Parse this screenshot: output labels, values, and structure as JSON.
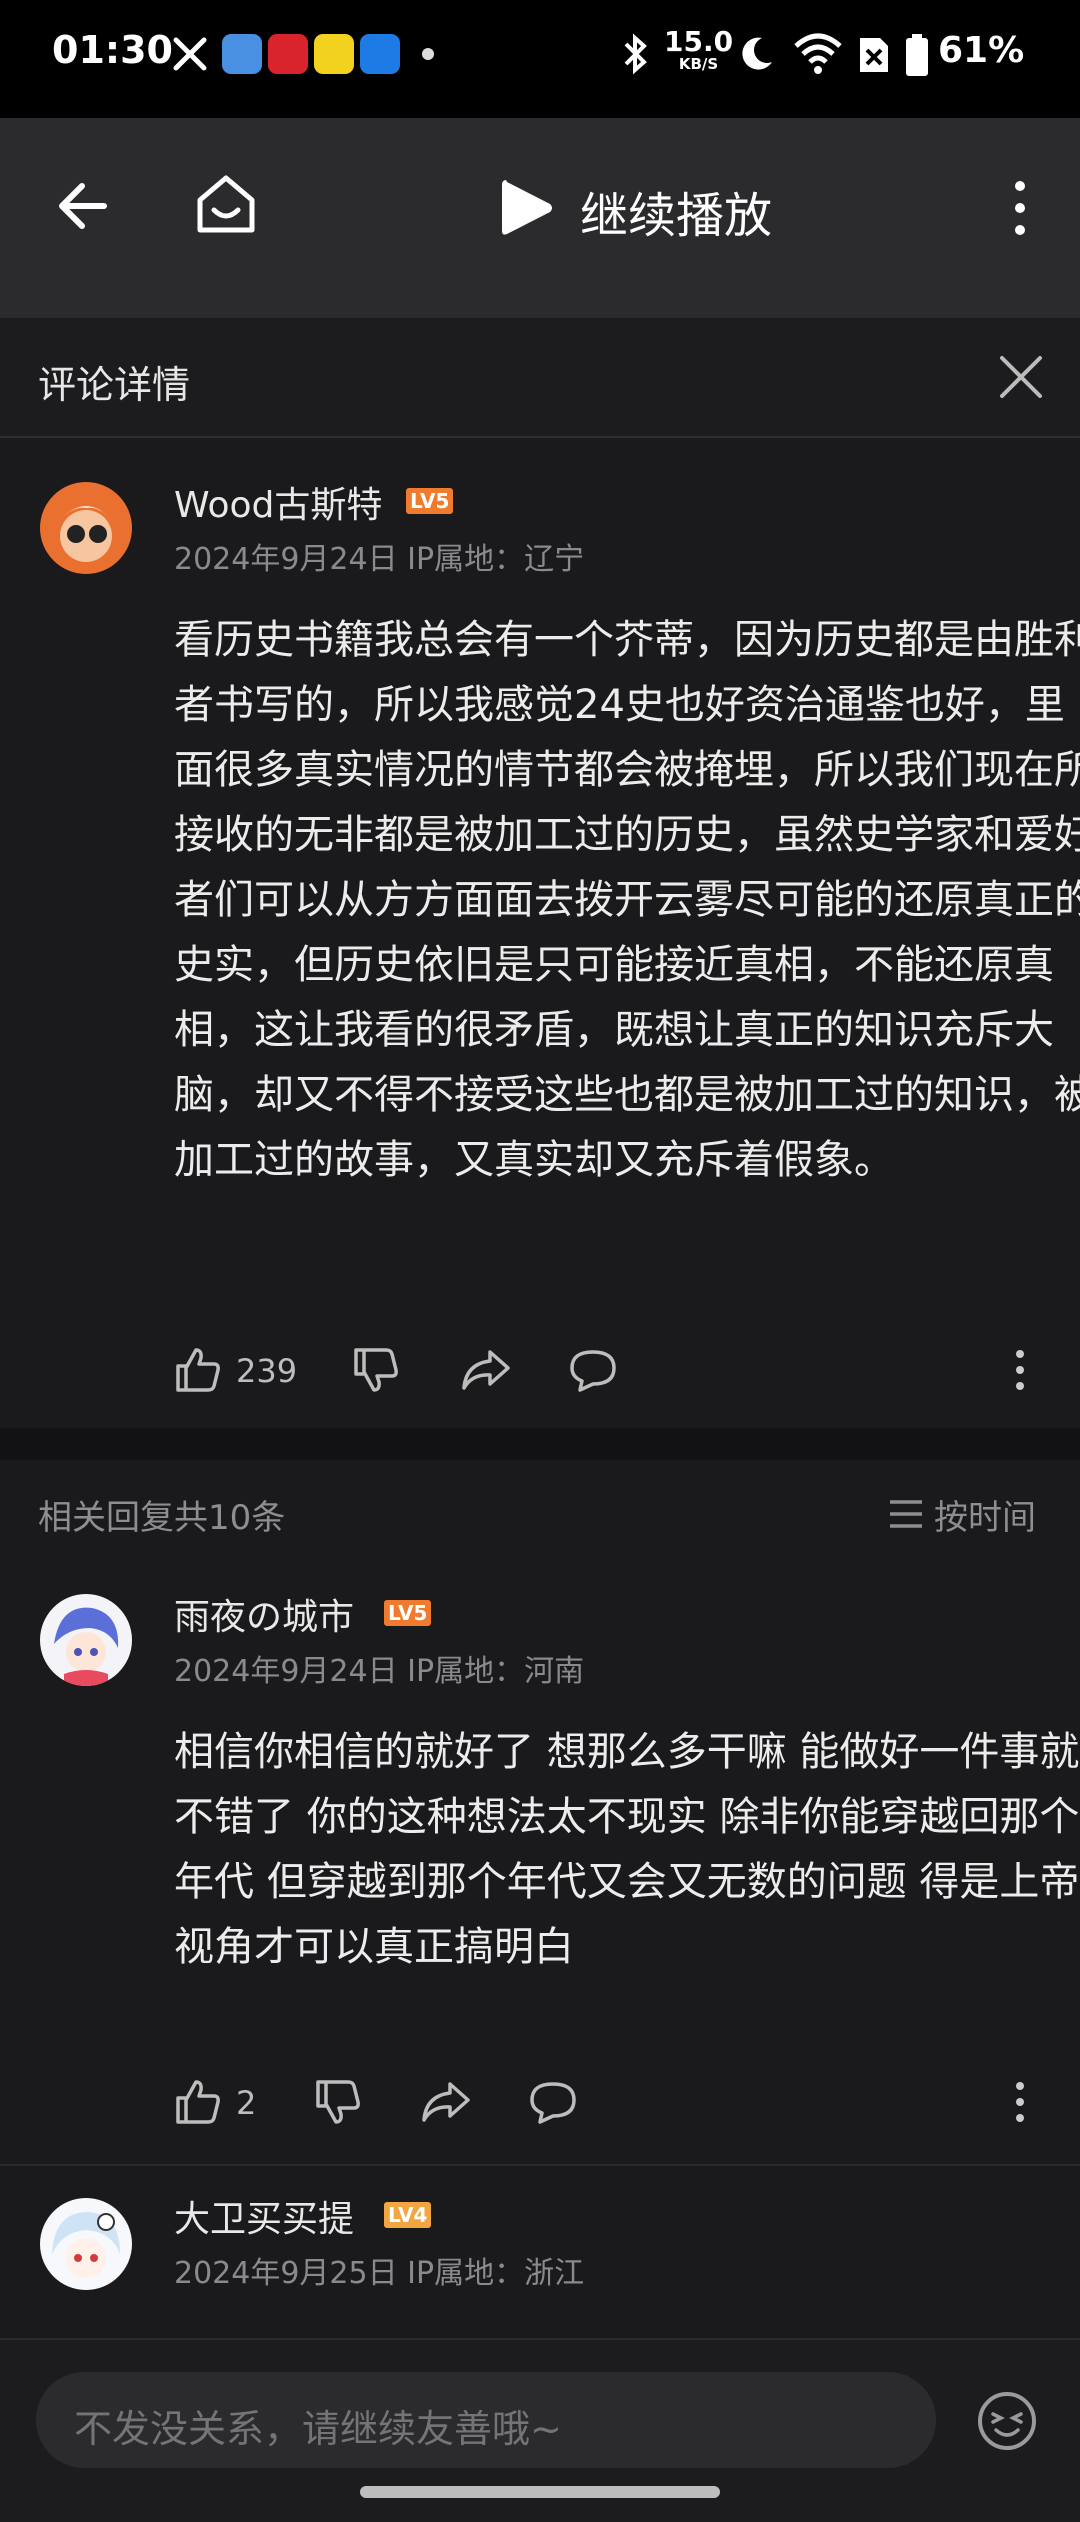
{
  "status_bar": {
    "time": "01:30",
    "net_speed_value": "15.0",
    "net_speed_unit": "KB/S",
    "battery": "61%"
  },
  "top_nav": {
    "play_label": "继续播放"
  },
  "detail_header": {
    "title": "评论详情"
  },
  "main_comment": {
    "username": "Wood古斯特",
    "level": "LV5",
    "meta": "2024年9月24日 IP属地：辽宁",
    "text": "看历史书籍我总会有一个芥蒂，因为历史都是由胜利者书写的，所以我感觉24史也好资治通鉴也好，里面很多真实情况的情节都会被掩埋，所以我们现在所接收的无非都是被加工过的历史，虽然史学家和爱好者们可以从方方面面去拨开云雾尽可能的还原真正的史实，但历史依旧是只可能接近真相，不能还原真相，这让我看的很矛盾，既想让真正的知识充斥大脑，却又不得不接受这些也都是被加工过的知识，被加工过的故事，又真实却又充斥着假象。",
    "likes": "239"
  },
  "replies_header": {
    "count_label": "相关回复共10条",
    "sort_label": "按时间"
  },
  "replies": [
    {
      "username": "雨夜の城市",
      "level": "LV5",
      "meta": "2024年9月24日 IP属地：河南",
      "text": "相信你相信的就好了  想那么多干嘛  能做好一件事就不错了 你的这种想法太不现实  除非你能穿越回那个年代  但穿越到那个年代又会又无数的问题 得是上帝视角才可以真正搞明白",
      "likes": "2"
    },
    {
      "username": "大卫买买提",
      "level": "LV4",
      "meta": "2024年9月25日 IP属地：浙江"
    }
  ],
  "input_bar": {
    "placeholder": "不发没关系，请继续友善哦~"
  },
  "colors": {
    "background": "#1a1a1c",
    "lv5_badge": "#f07a2e",
    "lv4_badge": "#f2a541"
  },
  "icons": [
    "back-arrow-icon",
    "home-icon",
    "play-icon",
    "more-vert-icon",
    "close-icon",
    "like-icon",
    "dislike-icon",
    "share-icon",
    "comment-icon",
    "sort-list-icon",
    "emoji-icon"
  ]
}
